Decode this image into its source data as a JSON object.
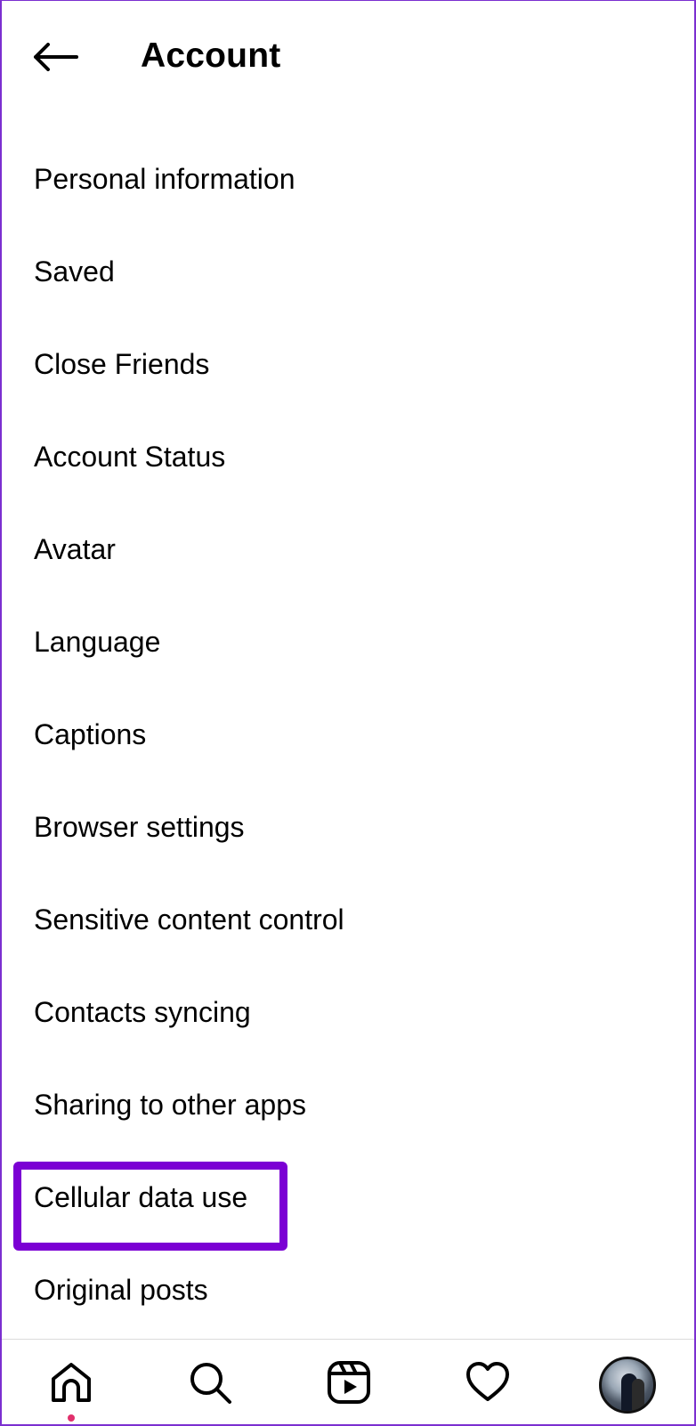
{
  "header": {
    "title": "Account",
    "back_icon": "arrow-left-icon"
  },
  "menu": {
    "items": [
      {
        "label": "Personal information"
      },
      {
        "label": "Saved"
      },
      {
        "label": "Close Friends"
      },
      {
        "label": "Account Status"
      },
      {
        "label": "Avatar"
      },
      {
        "label": "Language"
      },
      {
        "label": "Captions"
      },
      {
        "label": "Browser settings"
      },
      {
        "label": "Sensitive content control"
      },
      {
        "label": "Contacts syncing"
      },
      {
        "label": "Sharing to other apps"
      },
      {
        "label": "Cellular data use",
        "highlighted": true
      },
      {
        "label": "Original posts"
      }
    ]
  },
  "bottom_nav": {
    "items": [
      {
        "icon": "home-icon"
      },
      {
        "icon": "search-icon"
      },
      {
        "icon": "reels-icon"
      },
      {
        "icon": "heart-icon"
      },
      {
        "icon": "profile-avatar"
      }
    ],
    "notification_dot_color": "#e1306c"
  },
  "colors": {
    "highlight": "#7b00d4",
    "frame": "#7b2fd0",
    "text": "#000000"
  }
}
